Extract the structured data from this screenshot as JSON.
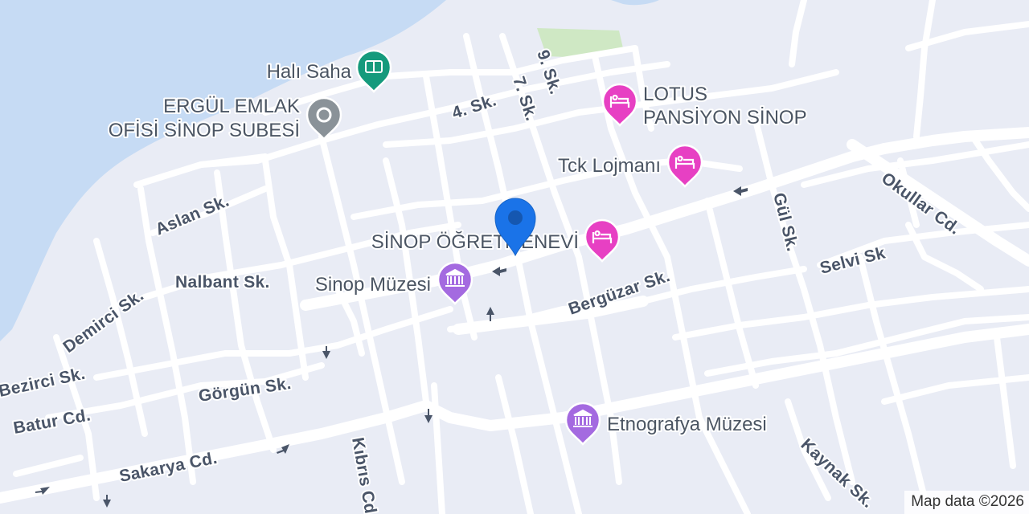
{
  "map": {
    "colors": {
      "water": "#c6dbf4",
      "land": "#e9ecf5",
      "road": "#ffffff",
      "park": "#cfe8c4",
      "lodging_pin": "#e740c3",
      "museum_pin": "#a46ae0",
      "sports_pin": "#159a7c",
      "generic_pin": "#8a9298",
      "location_marker": "#1a73e8"
    },
    "streets": {
      "s9": "9. Sk.",
      "s7": "7. Sk.",
      "s4": "4. Sk.",
      "aslan": "Aslan Sk.",
      "nalbant": "Nalbant Sk.",
      "demirci": "Demirci Sk.",
      "bezirci": "Bezirci Sk.",
      "batur": "Batur Cd.",
      "gorgun": "Görgün Sk.",
      "sakarya": "Sakarya Cd.",
      "kibris": "Kıbrıs Cd.",
      "berguzar": "Bergüzar Sk.",
      "gul": "Gül Sk.",
      "selvi": "Selvi Sk",
      "okullar": "Okullar Cd.",
      "kaynak": "Kaynak Sk."
    },
    "pois": {
      "hali_saha": {
        "label": "Halı Saha",
        "icon": "soccer-field-icon"
      },
      "ergul_emlak": {
        "line1": "ERGÜL EMLAK",
        "line2": "OFİSİ SİNOP SUBESİ",
        "icon": "generic-place-icon"
      },
      "lotus": {
        "line1": "LOTUS",
        "line2": "PANSİYON SİNOP",
        "icon": "bed-icon"
      },
      "tck": {
        "label": "Tck Lojmanı",
        "icon": "bed-icon"
      },
      "ogretmenevi": {
        "label": "SİNOP ÖĞRETMENEVİ",
        "icon": "bed-icon"
      },
      "sinop_muzesi": {
        "label": "Sinop Müzesi",
        "icon": "museum-icon"
      },
      "etnografya": {
        "label": "Etnografya Müzesi",
        "icon": "museum-icon"
      }
    },
    "attribution": "Map data ©2026"
  }
}
